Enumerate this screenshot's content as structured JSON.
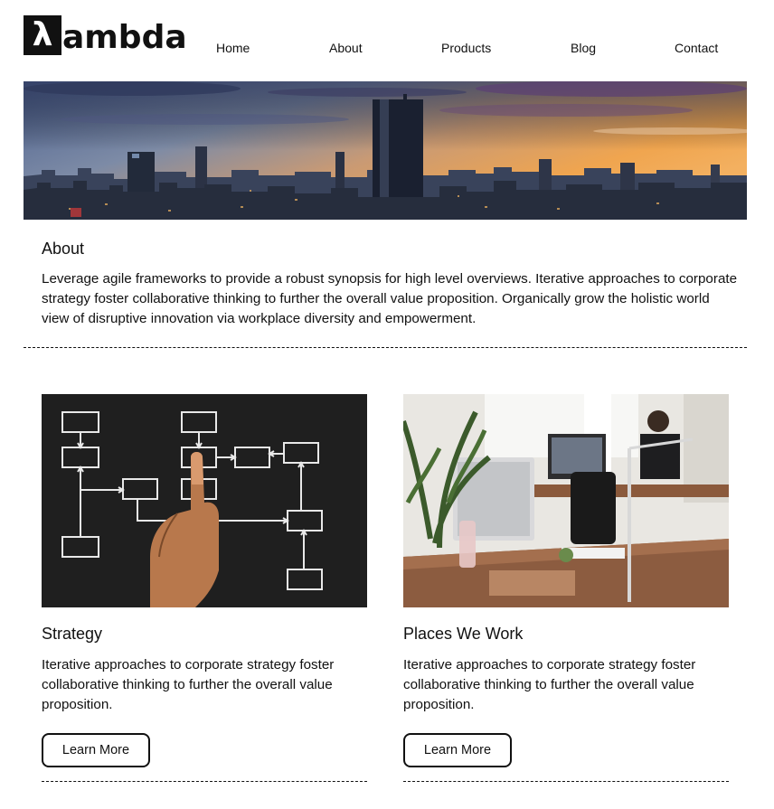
{
  "brand": {
    "logo_mark": "λ",
    "logo_text": "ambda"
  },
  "nav": [
    "Home",
    "About",
    "Products",
    "Blog",
    "Contact"
  ],
  "hero": {
    "alt": "city-skyline-at-sunset"
  },
  "about": {
    "title": "About",
    "text": "Leverage agile frameworks to provide a robust synopsis for high level overviews. Iterative approaches to corporate strategy foster collaborative thinking to further the overall value proposition. Organically grow the holistic world view of disruptive innovation via workplace diversity and empowerment."
  },
  "cards": [
    {
      "title": "Strategy",
      "text": "Iterative approaches to corporate strategy foster collaborative thinking to further the overall value proposition.",
      "button": "Learn More"
    },
    {
      "title": "Places We Work",
      "text": "Iterative approaches to corporate strategy foster collaborative thinking to further the overall value proposition.",
      "button": "Learn More"
    }
  ],
  "colors": {
    "text": "#111111",
    "chalkboard": "#1f1f1f",
    "sky_top": "#3a4a72",
    "sky_sunset": "#e89a4a"
  }
}
